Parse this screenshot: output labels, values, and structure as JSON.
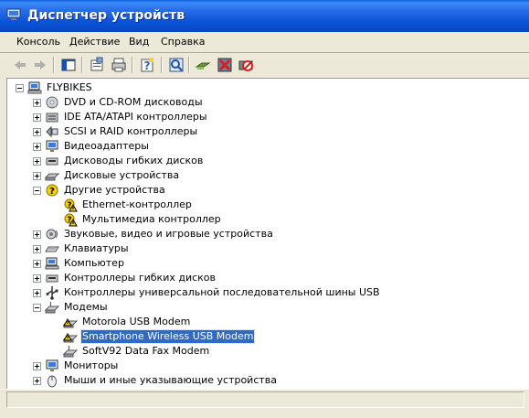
{
  "window": {
    "title": "Диспетчер устройств"
  },
  "menu": [
    "Консоль",
    "Действие",
    "Вид",
    "Справка"
  ],
  "toolbar": {
    "buttons": [
      "back-icon",
      "forward-icon",
      "show-hide-tree-icon",
      "properties-icon",
      "print-icon",
      "help-icon",
      "scan-hardware-icon",
      "update-driver-icon",
      "uninstall-icon",
      "disable-icon"
    ]
  },
  "tree": {
    "root": "FLYBIKES",
    "items": [
      {
        "label": "DVD и CD-ROM дисководы",
        "icon": "cdrom-icon",
        "level": 1,
        "expander": "plus"
      },
      {
        "label": "IDE ATA/ATAPI контроллеры",
        "icon": "ide-icon",
        "level": 1,
        "expander": "plus"
      },
      {
        "label": "SCSI и RAID контроллеры",
        "icon": "scsi-icon",
        "level": 1,
        "expander": "plus"
      },
      {
        "label": "Видеоадаптеры",
        "icon": "display-adapter-icon",
        "level": 1,
        "expander": "plus"
      },
      {
        "label": "Дисководы гибких дисков",
        "icon": "floppy-drive-icon",
        "level": 1,
        "expander": "plus"
      },
      {
        "label": "Дисковые устройства",
        "icon": "disk-drive-icon",
        "level": 1,
        "expander": "plus"
      },
      {
        "label": "Другие устройства",
        "icon": "unknown-device-icon",
        "level": 1,
        "expander": "minus"
      },
      {
        "label": "Ethernet-контроллер",
        "icon": "warning-device-icon",
        "level": 2,
        "expander": "none"
      },
      {
        "label": "Мультимедиа контроллер",
        "icon": "warning-device-icon",
        "level": 2,
        "expander": "none"
      },
      {
        "label": "Звуковые, видео и игровые устройства",
        "icon": "sound-icon",
        "level": 1,
        "expander": "plus"
      },
      {
        "label": "Клавиатуры",
        "icon": "keyboard-icon",
        "level": 1,
        "expander": "plus"
      },
      {
        "label": "Компьютер",
        "icon": "computer-icon",
        "level": 1,
        "expander": "plus"
      },
      {
        "label": "Контроллеры гибких дисков",
        "icon": "floppy-controller-icon",
        "level": 1,
        "expander": "plus"
      },
      {
        "label": "Контроллеры универсальной последовательной шины USB",
        "icon": "usb-icon",
        "level": 1,
        "expander": "plus"
      },
      {
        "label": "Модемы",
        "icon": "modem-icon",
        "level": 1,
        "expander": "minus"
      },
      {
        "label": "Motorola USB Modem",
        "icon": "modem-warning-icon",
        "level": 2,
        "expander": "none"
      },
      {
        "label": "Smartphone Wireless USB Modem",
        "icon": "modem-warning-icon",
        "level": 2,
        "expander": "none",
        "selected": true
      },
      {
        "label": "SoftV92 Data Fax Modem",
        "icon": "modem-icon",
        "level": 2,
        "expander": "none"
      },
      {
        "label": "Мониторы",
        "icon": "monitor-icon",
        "level": 1,
        "expander": "plus"
      },
      {
        "label": "Мыши и иные указывающие устройства",
        "icon": "mouse-icon",
        "level": 1,
        "expander": "plus"
      }
    ]
  },
  "colors": {
    "selection": "#316ac5",
    "titlebar": "#0a52d6",
    "warning": "#f7d100"
  }
}
